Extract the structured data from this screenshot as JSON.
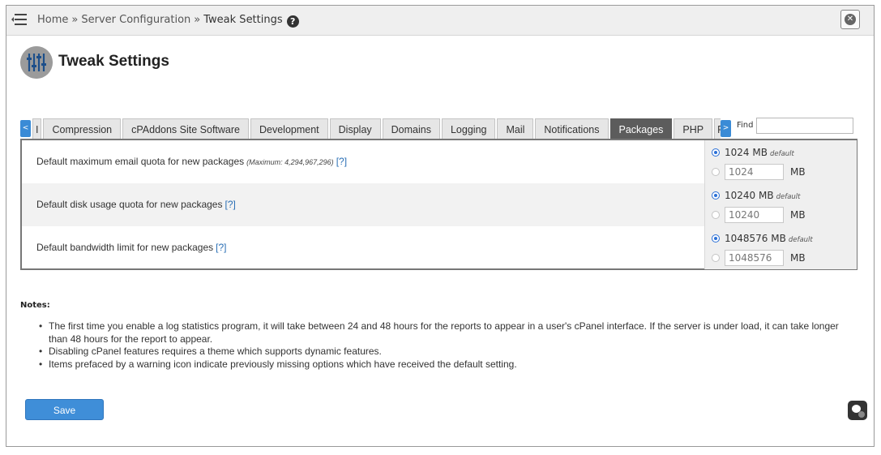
{
  "breadcrumb": {
    "home": "Home",
    "separator": "»",
    "section": "Server Configuration",
    "current": "Tweak Settings"
  },
  "page": {
    "title": "Tweak Settings"
  },
  "tabs": {
    "prev_arrow": "<",
    "next_arrow": ">",
    "items": [
      {
        "label": "I"
      },
      {
        "label": "Compression"
      },
      {
        "label": "cPAddons Site Software"
      },
      {
        "label": "Development"
      },
      {
        "label": "Display"
      },
      {
        "label": "Domains"
      },
      {
        "label": "Logging"
      },
      {
        "label": "Mail"
      },
      {
        "label": "Notifications"
      },
      {
        "label": "Packages",
        "active": true
      },
      {
        "label": "PHP"
      },
      {
        "label": "R"
      }
    ],
    "find_label": "Find",
    "find_value": ""
  },
  "settings": [
    {
      "label": "Default maximum email quota for new packages",
      "maximum_note": "(Maximum: 4,294,967,296)",
      "help": "[?]",
      "default_value": "1024 MB",
      "default_tag": "default",
      "custom_value": "1024",
      "unit": "MB",
      "selected": "default"
    },
    {
      "label": "Default disk usage quota for new packages",
      "help": "[?]",
      "default_value": "10240 MB",
      "default_tag": "default",
      "custom_value": "10240",
      "unit": "MB",
      "selected": "default"
    },
    {
      "label": "Default bandwidth limit for new packages",
      "help": "[?]",
      "default_value": "1048576 MB",
      "default_tag": "default",
      "custom_value": "1048576",
      "unit": "MB",
      "selected": "default"
    }
  ],
  "notes": {
    "title": "Notes:",
    "items": [
      "The first time you enable a log statistics program, it will take between 24 and 48 hours for the reports to appear in a user's cPanel interface. If the server is under load, it can take longer than 48 hours for the report to appear.",
      "Disabling cPanel features requires a theme which supports dynamic features.",
      "Items prefaced by a warning icon indicate previously missing options which have received the default setting."
    ]
  },
  "actions": {
    "save_label": "Save"
  },
  "icons": {
    "menu": "hamburger-menu-icon",
    "help": "question-circle-icon",
    "close": "close-circle-icon",
    "page": "sliders-icon",
    "chat": "chat-bot-icon"
  },
  "colors": {
    "accent": "#3f8ed8",
    "active_tab": "#5c5c5c",
    "link": "#2a6fb5"
  }
}
